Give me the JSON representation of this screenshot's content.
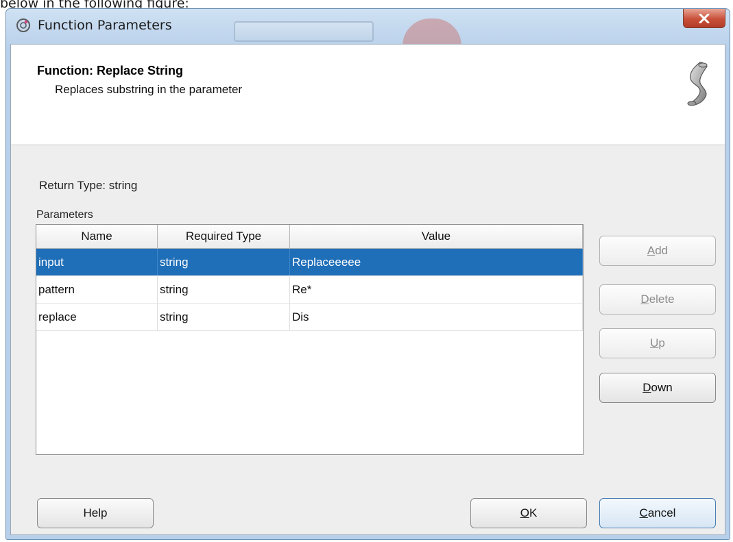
{
  "background_caption": "below in the following figure:",
  "window": {
    "title": "Function Parameters",
    "close_symbol": "X"
  },
  "header": {
    "function_title": "Function: Replace String",
    "description": "Replaces substring in the parameter"
  },
  "return_type": "Return Type: string",
  "parameters": {
    "label": "Parameters",
    "columns": [
      "Name",
      "Required Type",
      "Value"
    ],
    "rows": [
      {
        "name": "input",
        "type": "string",
        "value": "Replaceeeee",
        "selected": true
      },
      {
        "name": "pattern",
        "type": "string",
        "value": "Re*",
        "selected": false
      },
      {
        "name": "replace",
        "type": "string",
        "value": "Dis",
        "selected": false
      }
    ]
  },
  "side_buttons": {
    "add": {
      "mnemonic": "A",
      "rest": "dd"
    },
    "delete": {
      "mnemonic": "D",
      "rest": "elete"
    },
    "up": {
      "mnemonic": "U",
      "rest": "p"
    },
    "down": {
      "mnemonic": "D",
      "rest": "own"
    }
  },
  "footer_buttons": {
    "help": "Help",
    "ok": {
      "mnemonic": "O",
      "rest": "K"
    },
    "cancel": {
      "mnemonic": "C",
      "rest": "ancel"
    }
  },
  "colors": {
    "selection": "#1e6eb8",
    "close_button": "#c8503a"
  }
}
